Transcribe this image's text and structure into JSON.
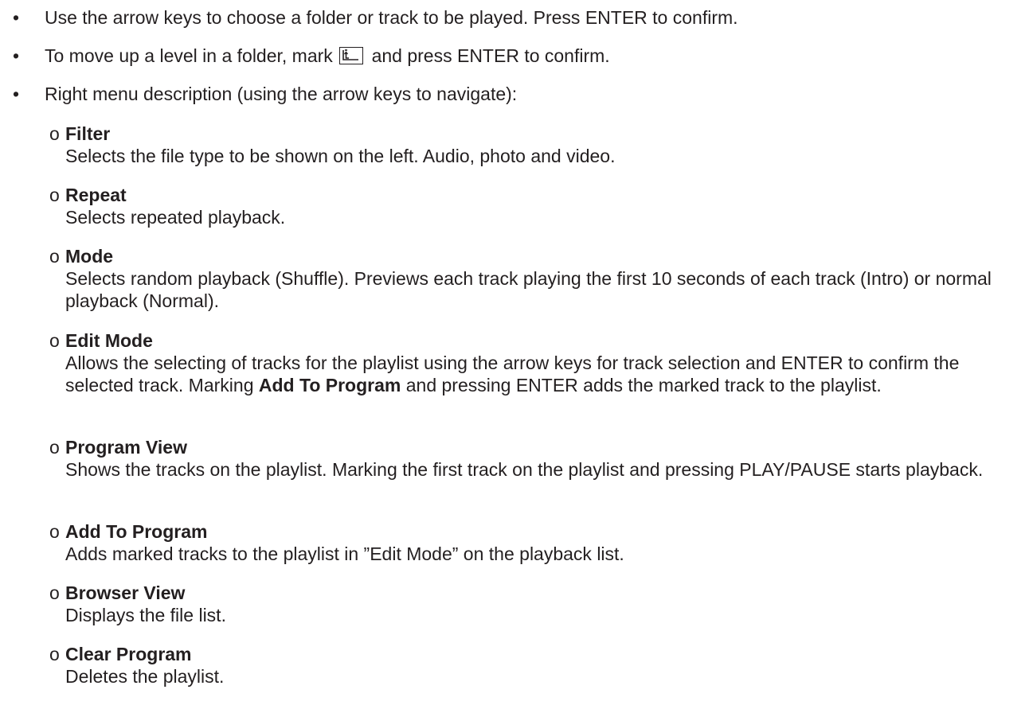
{
  "bullets": [
    {
      "marker": "•",
      "text": "Use the arrow keys to choose a folder or track to be played. Press ENTER to confirm."
    },
    {
      "marker": "•",
      "text_before": "To move up a level in a folder, mark",
      "icon": "folder-up-icon",
      "text_after": "and press ENTER to confirm."
    },
    {
      "marker": "•",
      "text": "Right menu description (using the arrow keys to navigate):"
    }
  ],
  "sub_marker": "o",
  "menu_items": [
    {
      "title": "Filter",
      "description": "Selects the file type to be shown on the left. Audio, photo and video."
    },
    {
      "title": "Repeat",
      "description": "Selects repeated playback."
    },
    {
      "title": "Mode",
      "description": "Selects random playback (Shuffle). Previews each track playing the first 10 seconds of each track (Intro) or normal playback (Normal)."
    },
    {
      "title": "Edit Mode",
      "description_1": "Allows the selecting of tracks for the playlist using the arrow keys for track selection and ENTER to confirm the selected track. Marking ",
      "description_bold": "Add To Program",
      "description_2": " and pressing ENTER adds the marked track to the playlist."
    },
    {
      "title": "Program View",
      "description": "Shows the tracks on the playlist. Marking the first track on the playlist and pressing PLAY/PAUSE starts playback."
    },
    {
      "title": "Add To Program",
      "description": "Adds marked tracks to the playlist in ”Edit Mode” on the playback list."
    },
    {
      "title": "Browser View",
      "description": "Displays the file list."
    },
    {
      "title": "Clear Program",
      "description": "Deletes the playlist."
    }
  ]
}
